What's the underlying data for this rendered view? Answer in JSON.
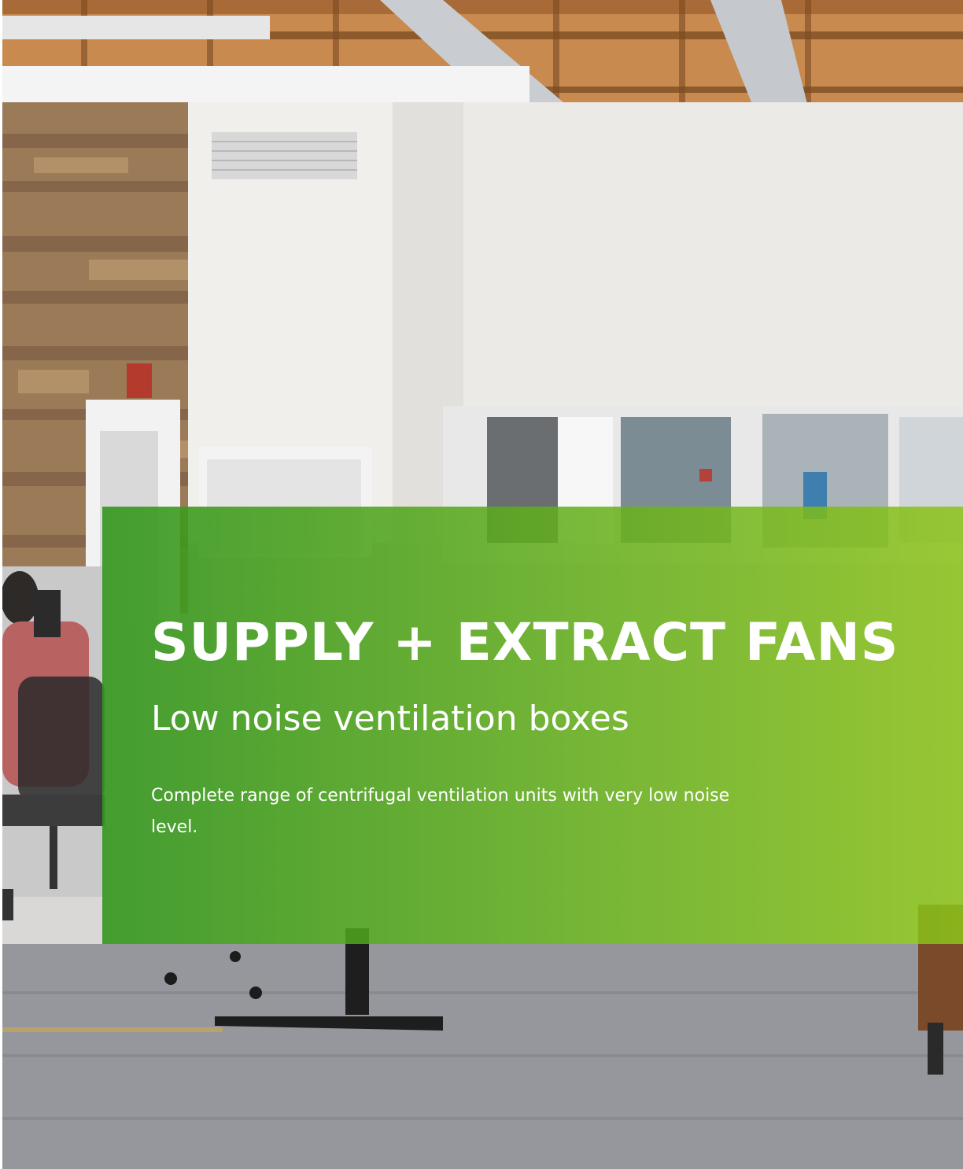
{
  "hero": {
    "title": "SUPPLY + EXTRACT FANS",
    "subtitle": "Low noise ventilation boxes",
    "body": "Complete range of centrifugal ventilation units with very low noise level."
  },
  "colors": {
    "panel_green_dark": "#34961e",
    "panel_green_light": "#8cc319",
    "text": "#ffffff"
  }
}
